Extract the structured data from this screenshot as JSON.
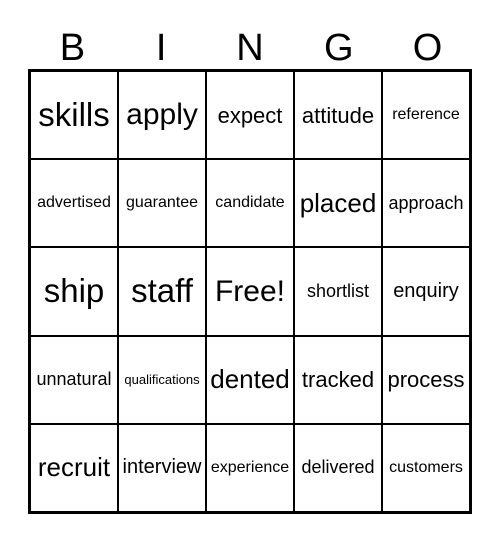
{
  "card": {
    "header": {
      "letters": [
        "B",
        "I",
        "N",
        "G",
        "O"
      ]
    },
    "rows": [
      {
        "cells": [
          {
            "text": "skills",
            "size": "s-xxl"
          },
          {
            "text": "apply",
            "size": "s-xl"
          },
          {
            "text": "expect",
            "size": "s-m"
          },
          {
            "text": "attitude",
            "size": "s-m"
          },
          {
            "text": "reference",
            "size": "s-xs"
          }
        ]
      },
      {
        "cells": [
          {
            "text": "advertised",
            "size": "s-xs"
          },
          {
            "text": "guarantee",
            "size": "s-xs"
          },
          {
            "text": "candidate",
            "size": "s-xs"
          },
          {
            "text": "placed",
            "size": "s-l"
          },
          {
            "text": "approach",
            "size": "s-s"
          }
        ]
      },
      {
        "cells": [
          {
            "text": "ship",
            "size": "s-xxl"
          },
          {
            "text": "staff",
            "size": "s-xxl"
          },
          {
            "text": "Free!",
            "size": "s-xl"
          },
          {
            "text": "shortlist",
            "size": "s-s"
          },
          {
            "text": "enquiry",
            "size": "s-sm"
          }
        ]
      },
      {
        "cells": [
          {
            "text": "unnatural",
            "size": "s-s"
          },
          {
            "text": "qualifications",
            "size": "s-xxs"
          },
          {
            "text": "dented",
            "size": "s-l"
          },
          {
            "text": "tracked",
            "size": "s-m"
          },
          {
            "text": "process",
            "size": "s-m"
          }
        ]
      },
      {
        "cells": [
          {
            "text": "recruit",
            "size": "s-l"
          },
          {
            "text": "interview",
            "size": "s-sm"
          },
          {
            "text": "experience",
            "size": "s-xs"
          },
          {
            "text": "delivered",
            "size": "s-s"
          },
          {
            "text": "customers",
            "size": "s-xs"
          }
        ]
      }
    ]
  }
}
